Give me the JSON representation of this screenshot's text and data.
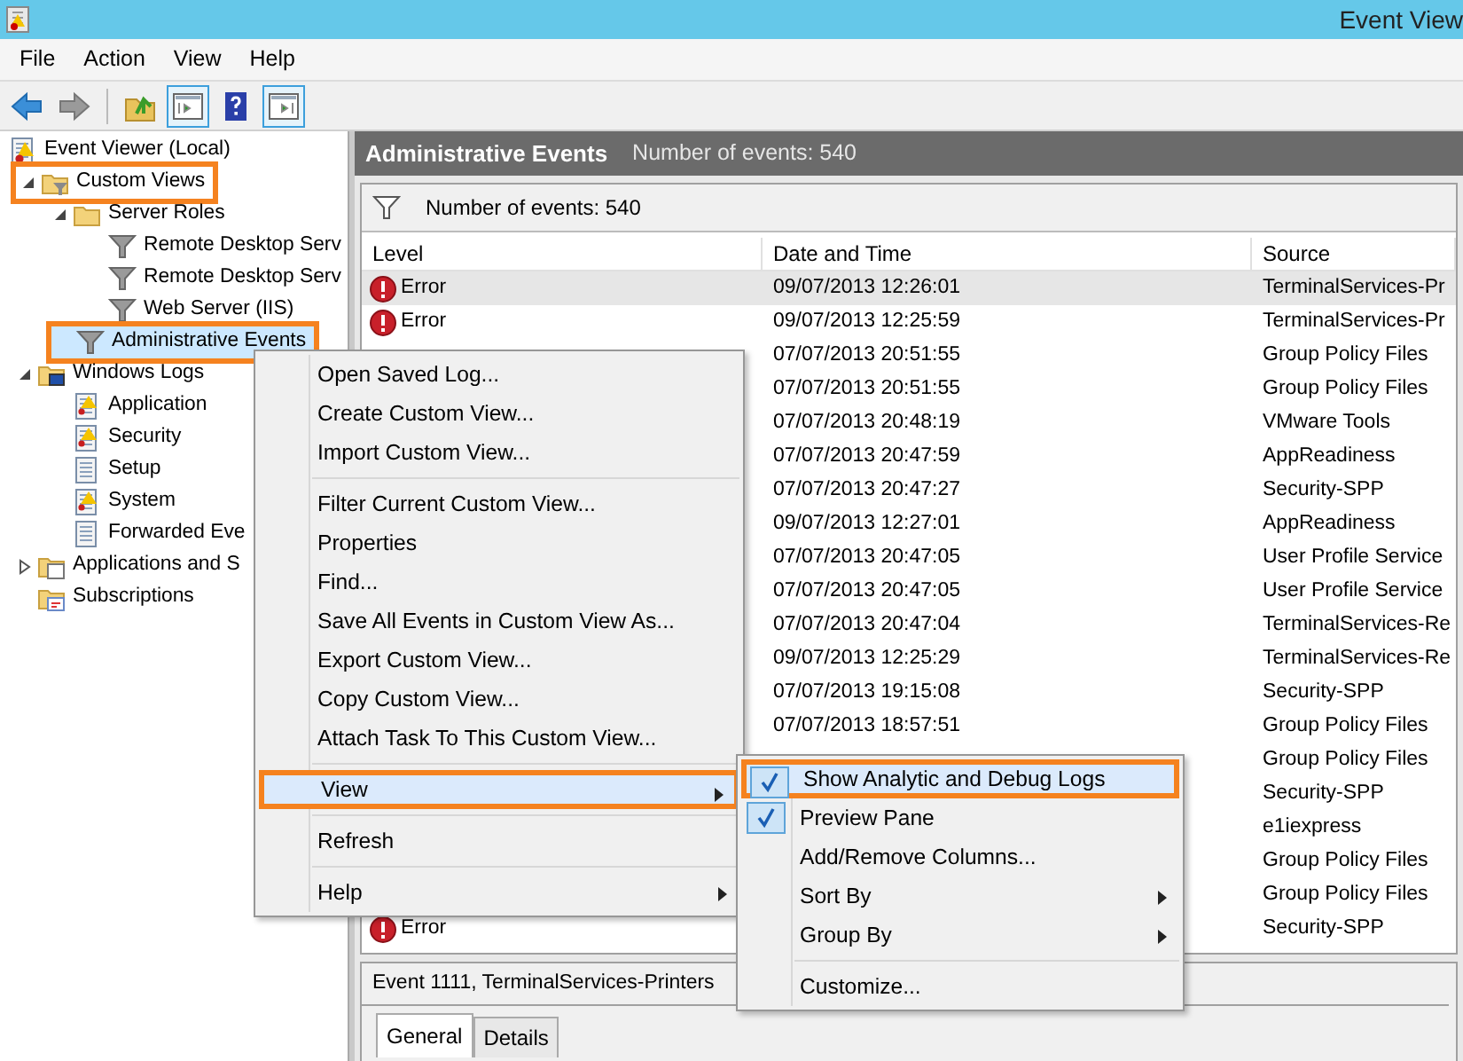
{
  "window": {
    "title": "Event View"
  },
  "menu_bar": [
    "File",
    "Action",
    "View",
    "Help"
  ],
  "tree": [
    {
      "label": "Event Viewer (Local)",
      "kind": "viewer",
      "selected": false,
      "highlighted": false,
      "children": [
        {
          "label": "Custom Views",
          "kind": "folder-filter",
          "expanded": true,
          "selected": false,
          "highlighted": true,
          "children": [
            {
              "label": "Server Roles",
              "kind": "folder",
              "expanded": true,
              "selected": false,
              "highlighted": false,
              "children": [
                {
                  "label": "Remote Desktop Serv",
                  "kind": "filter",
                  "selected": false,
                  "highlighted": false
                },
                {
                  "label": "Remote Desktop Serv",
                  "kind": "filter",
                  "selected": false,
                  "highlighted": false
                },
                {
                  "label": "Web Server (IIS)",
                  "kind": "filter",
                  "selected": false,
                  "highlighted": false
                }
              ]
            },
            {
              "label": "Administrative Events",
              "kind": "filter",
              "selected": true,
              "highlighted": true
            }
          ]
        },
        {
          "label": "Windows Logs",
          "kind": "folder-monitor",
          "expanded": true,
          "selected": false,
          "highlighted": false,
          "children": [
            {
              "label": "Application",
              "kind": "log-alert",
              "selected": false,
              "highlighted": false
            },
            {
              "label": "Security",
              "kind": "log-alert",
              "selected": false,
              "highlighted": false
            },
            {
              "label": "Setup",
              "kind": "log",
              "selected": false,
              "highlighted": false
            },
            {
              "label": "System",
              "kind": "log-alert",
              "selected": false,
              "highlighted": false
            },
            {
              "label": "Forwarded Eve",
              "kind": "log",
              "selected": false,
              "highlighted": false
            }
          ]
        },
        {
          "label": "Applications and S",
          "kind": "folder-doc",
          "expanded": false,
          "selected": false,
          "highlighted": false
        },
        {
          "label": "Subscriptions",
          "kind": "subscriptions",
          "selected": false,
          "highlighted": false
        }
      ]
    }
  ],
  "header": {
    "title": "Administrative Events",
    "count": "Number of events: 540"
  },
  "filter_bar": {
    "text": "Number of events: 540"
  },
  "table": {
    "columns": [
      "Level",
      "Date and Time",
      "Source"
    ],
    "rows": [
      {
        "kind": "error",
        "level": "Error",
        "date": "09/07/2013 12:26:01",
        "source": "TerminalServices-Pr",
        "selected": true
      },
      {
        "kind": "error",
        "level": "Error",
        "date": "09/07/2013 12:25:59",
        "source": "TerminalServices-Pr",
        "selected": false
      },
      {
        "date": "07/07/2013 20:51:55",
        "source": "Group Policy Files",
        "selected": false
      },
      {
        "date": "07/07/2013 20:51:55",
        "source": "Group Policy Files",
        "selected": false
      },
      {
        "date": "07/07/2013 20:48:19",
        "source": "VMware Tools",
        "selected": false
      },
      {
        "date": "07/07/2013 20:47:59",
        "source": "AppReadiness",
        "selected": false
      },
      {
        "date": "07/07/2013 20:47:27",
        "source": "Security-SPP",
        "selected": false
      },
      {
        "date": "09/07/2013 12:27:01",
        "source": "AppReadiness",
        "selected": false
      },
      {
        "date": "07/07/2013 20:47:05",
        "source": "User Profile Service",
        "selected": false
      },
      {
        "date": "07/07/2013 20:47:05",
        "source": "User Profile Service",
        "selected": false
      },
      {
        "date": "07/07/2013 20:47:04",
        "source": "TerminalServices-Re",
        "selected": false
      },
      {
        "date": "09/07/2013 12:25:29",
        "source": "TerminalServices-Re",
        "selected": false
      },
      {
        "date": "07/07/2013 19:15:08",
        "source": "Security-SPP",
        "selected": false
      },
      {
        "date": "07/07/2013 18:57:51",
        "source": "Group Policy Files",
        "selected": false
      },
      {
        "source": "Group Policy Files",
        "selected": false
      },
      {
        "source": "Security-SPP",
        "selected": false
      },
      {
        "source": "e1iexpress",
        "selected": false
      },
      {
        "source": "Group Policy Files",
        "selected": false
      },
      {
        "source": "Group Policy Files",
        "selected": false
      },
      {
        "kind": "error",
        "level": "Error",
        "source": "Security-SPP",
        "selected": false
      }
    ]
  },
  "preview": {
    "title": "Event 1111, TerminalServices-Printers",
    "tabs": [
      {
        "label": "General",
        "selected": true
      },
      {
        "label": "Details",
        "selected": false
      }
    ]
  },
  "context_menu": [
    {
      "kind": "item",
      "label": "Open Saved Log...",
      "selected": false,
      "highlighted": false
    },
    {
      "kind": "item",
      "label": "Create Custom View...",
      "selected": false,
      "highlighted": false
    },
    {
      "kind": "item",
      "label": "Import Custom View...",
      "selected": false,
      "highlighted": false
    },
    {
      "kind": "separator"
    },
    {
      "kind": "item",
      "label": "Filter Current Custom View...",
      "selected": false,
      "highlighted": false
    },
    {
      "kind": "item",
      "label": "Properties",
      "selected": false,
      "highlighted": false
    },
    {
      "kind": "item",
      "label": "Find...",
      "selected": false,
      "highlighted": false
    },
    {
      "kind": "item",
      "label": "Save All Events in Custom View As...",
      "selected": false,
      "highlighted": false
    },
    {
      "kind": "item",
      "label": "Export Custom View...",
      "selected": false,
      "highlighted": false
    },
    {
      "kind": "item",
      "label": "Copy Custom View...",
      "selected": false,
      "highlighted": false
    },
    {
      "kind": "item",
      "label": "Attach Task To This Custom View...",
      "selected": false,
      "highlighted": false
    },
    {
      "kind": "separator"
    },
    {
      "kind": "submenu",
      "label": "View",
      "selected": true,
      "highlighted": true
    },
    {
      "kind": "separator"
    },
    {
      "kind": "item",
      "label": "Refresh",
      "selected": false,
      "highlighted": false
    },
    {
      "kind": "separator"
    },
    {
      "kind": "submenu",
      "label": "Help",
      "selected": false,
      "highlighted": false
    }
  ],
  "view_submenu": [
    {
      "kind": "item",
      "label": "Show Analytic and Debug Logs",
      "checked": true,
      "selected": true,
      "highlighted": true
    },
    {
      "kind": "item",
      "label": "Preview Pane",
      "checked": true,
      "selected": false,
      "highlighted": false
    },
    {
      "kind": "item",
      "label": "Add/Remove Columns...",
      "checked": false,
      "selected": false,
      "highlighted": false
    },
    {
      "kind": "submenu",
      "label": "Sort By",
      "checked": false,
      "selected": false,
      "highlighted": false
    },
    {
      "kind": "submenu",
      "label": "Group By",
      "checked": false,
      "selected": false,
      "highlighted": false
    },
    {
      "kind": "separator"
    },
    {
      "kind": "item",
      "label": "Customize...",
      "checked": false,
      "selected": false,
      "highlighted": false
    }
  ]
}
